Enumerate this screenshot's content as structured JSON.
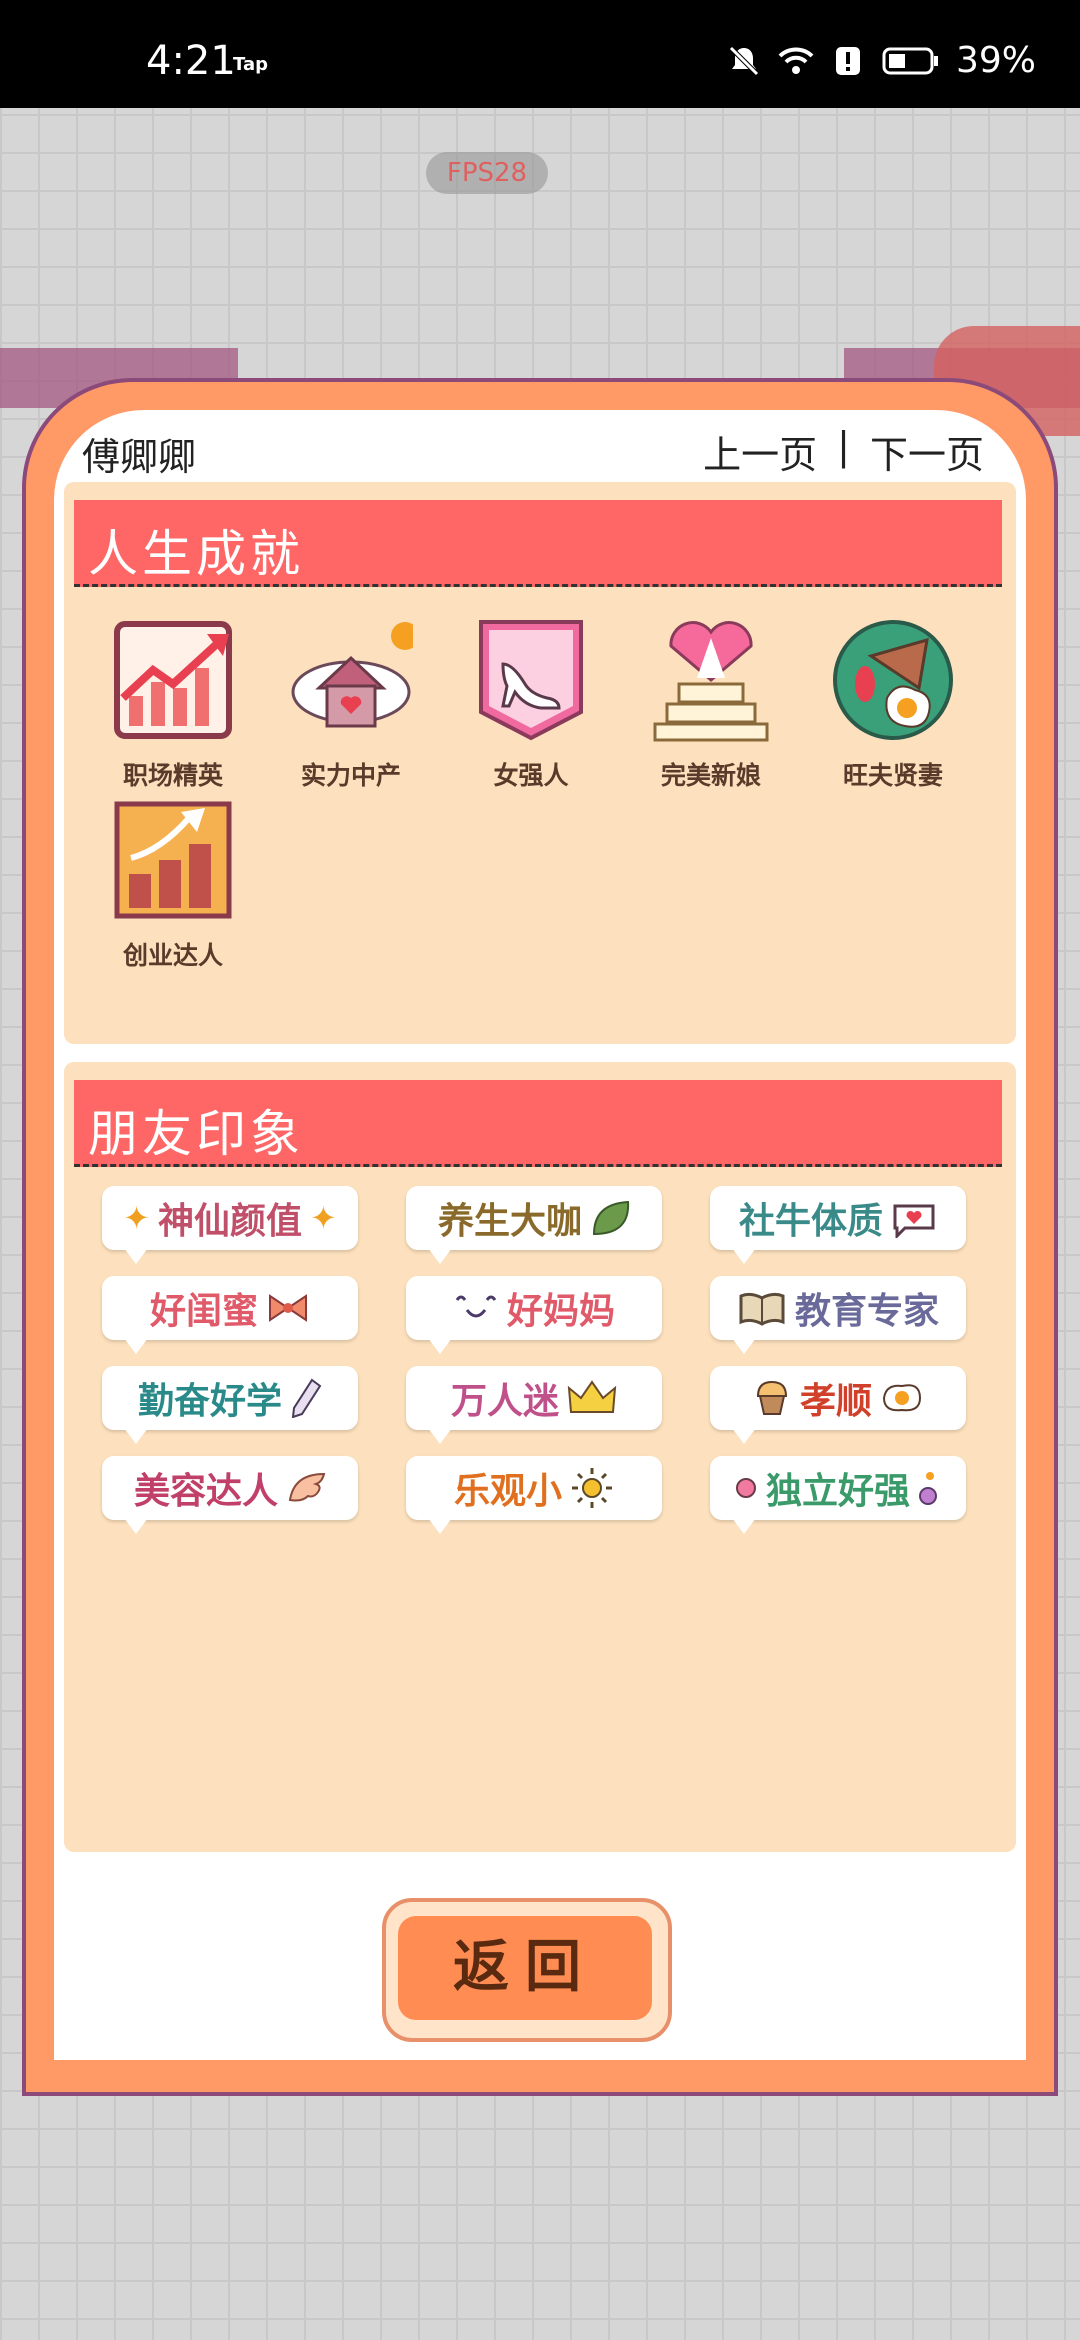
{
  "status_bar": {
    "time": "4:21",
    "tap": "Tap",
    "battery": "39%"
  },
  "fps": "FPS28",
  "player_name": "傅卿卿",
  "pager": {
    "prev": "上一页",
    "separator": "|",
    "next": "下一页"
  },
  "achievements": {
    "title": "人生成就",
    "items": [
      {
        "label": "职场精英",
        "icon": "rising-chart-icon"
      },
      {
        "label": "实力中产",
        "icon": "house-cloud-icon"
      },
      {
        "label": "女强人",
        "icon": "high-heel-icon"
      },
      {
        "label": "完美新娘",
        "icon": "wedding-cake-icon"
      },
      {
        "label": "旺夫贤妻",
        "icon": "breakfast-plate-icon"
      },
      {
        "label": "创业达人",
        "icon": "bar-growth-icon"
      }
    ]
  },
  "impressions": {
    "title": "朋友印象",
    "tags": [
      {
        "text": "神仙颜值",
        "color": "#c0506a",
        "icon": "sparkle-icon"
      },
      {
        "text": "养生大咖",
        "color": "#8a6a2a",
        "icon": "leaf-icon"
      },
      {
        "text": "社牛体质",
        "color": "#3a8a8a",
        "icon": "speech-heart-icon"
      },
      {
        "text": "好闺蜜",
        "color": "#e05a6a",
        "icon": "bow-icon"
      },
      {
        "text": "好妈妈",
        "color": "#e05a6a",
        "icon": "smile-icon"
      },
      {
        "text": "教育专家",
        "color": "#6a6a9a",
        "icon": "book-icon"
      },
      {
        "text": "勤奋好学",
        "color": "#2a8a8a",
        "icon": "pencil-icon"
      },
      {
        "text": "万人迷",
        "color": "#c0508a",
        "icon": "crown-icon"
      },
      {
        "text": "孝顺",
        "color": "#d0402a",
        "icon": "muffin-icon"
      },
      {
        "text": "美容达人",
        "color": "#c0406a",
        "icon": "wing-icon"
      },
      {
        "text": "乐观小",
        "color": "#e07020",
        "icon": "sun-icon"
      },
      {
        "text": "独立好强",
        "color": "#3a9a6a",
        "icon": "dot-icon"
      }
    ]
  },
  "back_button": "返回"
}
